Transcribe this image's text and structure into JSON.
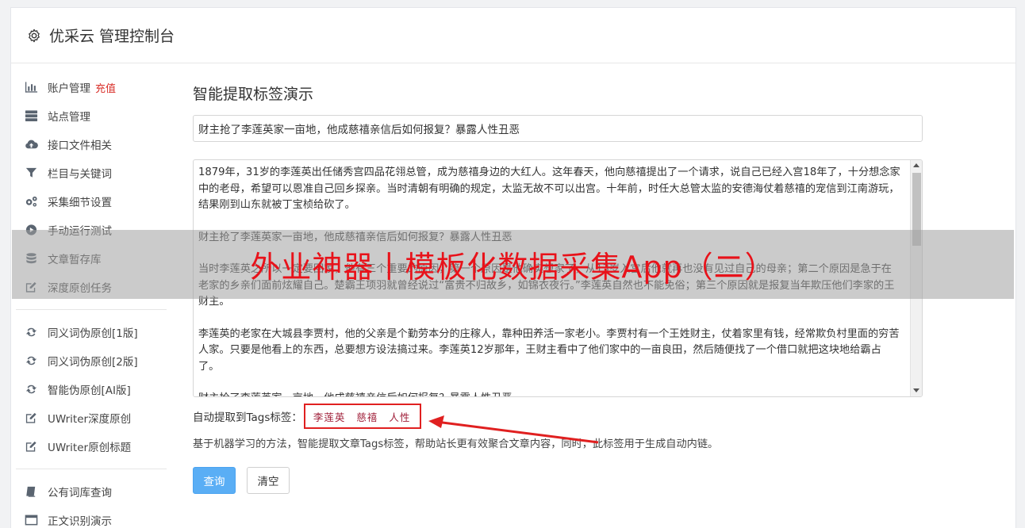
{
  "header": {
    "title": "优采云 管理控制台",
    "icon": "gear-icon"
  },
  "sidebar": {
    "group1": [
      {
        "label": "账户管理",
        "badge": "充值",
        "icon": "bar-chart-icon"
      },
      {
        "label": "站点管理",
        "icon": "server-icon"
      },
      {
        "label": "接口文件相关",
        "icon": "cloud-upload-icon"
      },
      {
        "label": "栏目与关键词",
        "icon": "filter-icon"
      },
      {
        "label": "采集细节设置",
        "icon": "gears-icon"
      },
      {
        "label": "手动运行测试",
        "icon": "play-icon"
      },
      {
        "label": "文章暂存库",
        "icon": "database-icon"
      },
      {
        "label": "深度原创任务",
        "icon": "edit-icon"
      }
    ],
    "group2": [
      {
        "label": "同义词伪原创[1版]",
        "icon": "refresh-icon"
      },
      {
        "label": "同义词伪原创[2版]",
        "icon": "refresh-icon"
      },
      {
        "label": "智能伪原创[AI版]",
        "icon": "refresh-icon"
      },
      {
        "label": "UWriter深度原创",
        "icon": "edit-icon"
      },
      {
        "label": "UWriter原创标题",
        "icon": "edit-icon"
      }
    ],
    "group3": [
      {
        "label": "公有词库查询",
        "icon": "book-icon"
      },
      {
        "label": "正文识别演示",
        "icon": "window-icon"
      }
    ]
  },
  "main": {
    "page_title": "智能提取标签演示",
    "title_value": "财主抢了李莲英家一亩地，他成慈禧亲信后如何报复？暴露人性丑恶",
    "content_paragraphs": [
      "1879年，31岁的李莲英出任储秀宫四品花翎总管，成为慈禧身边的大红人。这年春天，他向慈禧提出了一个请求，说自己已经入宫18年了，十分想念家中的老母，希望可以恩准自己回乡探亲。当时清朝有明确的规定，太监无故不可以出宫。十年前，时任大总管太监的安德海仗着慈禧的宠信到江南游玩，结果刚到山东就被丁宝桢给砍了。",
      "财主抢了李莲英家一亩地，他成慈禧亲信后如何报复？暴露人性丑恶",
      "当时李莲英之所以一定要回家，他有三个重要的原因，第一个原因是他确实想家了，从13岁入宫后他就再也没有见过自己的母亲；第二个原因是急于在老家的乡亲们面前炫耀自己。楚霸王项羽就曾经说过“富贵不归故乡，如锦衣夜行。”李莲英自然也不能免俗；第三个原因就是报复当年欺压他们李家的王财主。",
      "李莲英的老家在大城县李贾村，他的父亲是个勤劳本分的庄稼人，靠种田养活一家老小。李贾村有一个王姓财主，仗着家里有钱，经常欺负村里面的穷苦人家。只要是他看上的东西，总要想方设法搞过来。李莲英12岁那年，王财主看中了他们家中的一亩良田，然后随便找了一个借口就把这块地给霸占了。",
      "财主抢了李莲英家一亩地，他成慈禧亲信后如何报复？暴露人性丑恶"
    ],
    "tags_label": "自动提取到Tags标签：",
    "tags": [
      "李莲英",
      "慈禧",
      "人性"
    ],
    "description": "基于机器学习的方法，智能提取文章Tags标签，帮助站长更有效聚合文章内容，同时，此标签用于生成自动内链。",
    "query_button": "查询",
    "clear_button": "清空"
  },
  "overlay": {
    "text": "外业神器丨模板化数据采集App（二）"
  },
  "colors": {
    "accent": "#5aaef5",
    "highlight": "#e02020",
    "badge": "#d9302a"
  }
}
